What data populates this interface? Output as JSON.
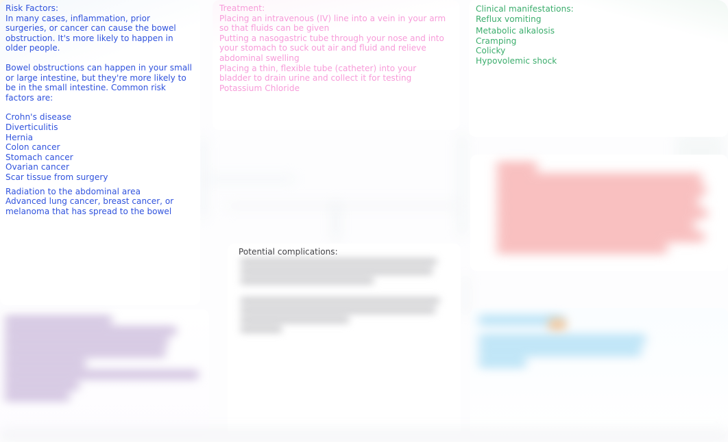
{
  "page": {
    "title": "Bowel Obstruction Clinical Notes Board",
    "background": "#fdfdfe"
  },
  "colors": {
    "risk_text": "#2f52dd",
    "treatment_text": "#f79bd9",
    "clinical_text": "#3bad6c",
    "complications_text": "#3c3c40",
    "purple_block": "#c6b4d8",
    "red_block": "#f6a6a6",
    "cyan_block": "#a9dcf4",
    "yellow_wash": "#f6dea0"
  },
  "risk_factors": {
    "heading": "Risk Factors:",
    "paragraph_1": "In many cases, inflammation, prior surgeries, or cancer can cause the bowel obstruction. It's more likely to happen in older people.",
    "paragraph_2": "Bowel obstructions can happen in your small or large intestine, but they're more likely to be in the small intestine. Common risk factors are:",
    "items": [
      "Crohn's disease",
      "Diverticulitis",
      "Hernia",
      "Colon cancer",
      "Stomach cancer",
      "Ovarian cancer",
      "Scar tissue from surgery"
    ],
    "items_extra": [
      "Radiation to the abdominal area",
      "Advanced lung cancer, breast cancer, or melanoma that has spread to the bowel"
    ]
  },
  "treatment": {
    "heading": "Treatment:",
    "items": [
      "Placing an intravenous (IV) line into a vein in your arm so that fluids can be given",
      "Putting a nasogastric tube through your nose and into your stomach to suck out air and fluid and relieve abdominal swelling",
      "Placing a thin, flexible tube (catheter) into your bladder to drain urine and collect it for testing",
      "Potassium Chloride"
    ]
  },
  "clinical_manifestations": {
    "heading": "Clinical manifestations:",
    "items": [
      "Reflux vomiting",
      "Metabolic alkalosis",
      "Cramping",
      "Colicky",
      "Hypovolemic shock"
    ]
  },
  "complications": {
    "heading": "Potential complications:",
    "body_status": "blurred-illegible"
  },
  "redacted_blocks": [
    {
      "name": "complications-body",
      "color": "#c9c9cc",
      "status": "blurred-illegible"
    },
    {
      "name": "purple-notes",
      "color": "#c6b4d8",
      "status": "blurred-illegible"
    },
    {
      "name": "red-notes",
      "color": "#f6a6a6",
      "status": "blurred-illegible"
    },
    {
      "name": "cyan-notes",
      "color": "#a9dcf4",
      "status": "blurred-illegible"
    }
  ]
}
